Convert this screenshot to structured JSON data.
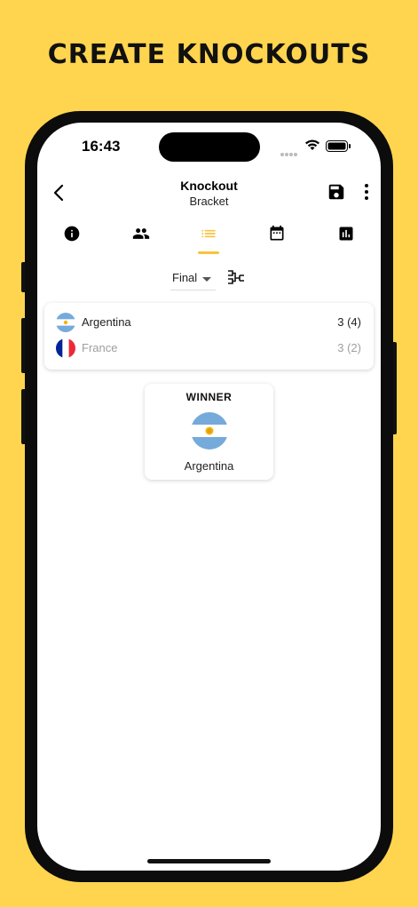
{
  "promo": {
    "headline": "CREATE KNOCKOUTS"
  },
  "status_bar": {
    "time": "16:43"
  },
  "app_bar": {
    "title": "Knockout",
    "subtitle": "Bracket"
  },
  "tabs": [
    {
      "icon": "info-icon"
    },
    {
      "icon": "people-icon"
    },
    {
      "icon": "list-icon",
      "selected": true
    },
    {
      "icon": "calendar-icon"
    },
    {
      "icon": "bar-chart-icon"
    }
  ],
  "round_selector": {
    "value": "Final"
  },
  "match": {
    "home": {
      "name": "Argentina",
      "score": "3 (4)"
    },
    "away": {
      "name": "France",
      "score": "3 (2)"
    }
  },
  "winner": {
    "label": "WINNER",
    "team": "Argentina"
  },
  "colors": {
    "background": "#FFD54F",
    "accent": "#F9C33A",
    "loser_text": "#9E9E9E"
  }
}
